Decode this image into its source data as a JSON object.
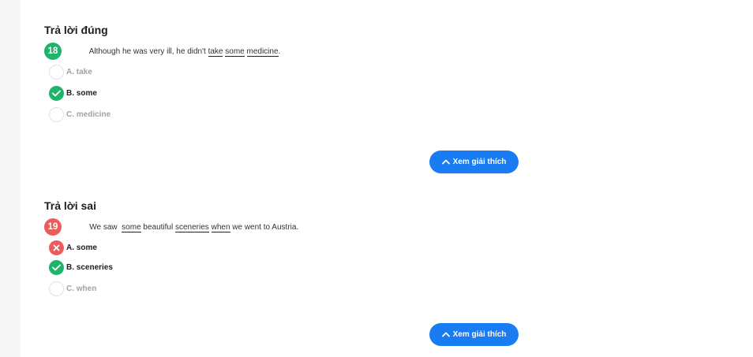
{
  "questions": [
    {
      "status": "Trả lời đúng",
      "number": "18",
      "text_parts": [
        {
          "t": "Although he was very ill, he didn't ",
          "u": false
        },
        {
          "t": "take",
          "u": true
        },
        {
          "t": " ",
          "u": false
        },
        {
          "t": "some",
          "u": true
        },
        {
          "t": " ",
          "u": false
        },
        {
          "t": "medicine",
          "u": true
        },
        {
          "t": ".",
          "u": false
        }
      ],
      "options": [
        {
          "label": "A. take",
          "state": "empty"
        },
        {
          "label": "B. some",
          "state": "correct"
        },
        {
          "label": "C. medicine",
          "state": "empty"
        }
      ],
      "button_label": "Xem giải thích"
    },
    {
      "status": "Trả lời sai",
      "number": "19",
      "text_parts": [
        {
          "t": "We saw  ",
          "u": false
        },
        {
          "t": "some",
          "u": true
        },
        {
          "t": " beautiful ",
          "u": false
        },
        {
          "t": "sceneries",
          "u": true
        },
        {
          "t": " ",
          "u": false
        },
        {
          "t": "when",
          "u": true
        },
        {
          "t": " we went to Austria.",
          "u": false
        }
      ],
      "options": [
        {
          "label": "A. some",
          "state": "wrong"
        },
        {
          "label": "B. sceneries",
          "state": "correct"
        },
        {
          "label": "C. when",
          "state": "empty"
        }
      ],
      "button_label": "Xem giải thích"
    }
  ],
  "colors": {
    "correct": "#1fb36b",
    "wrong": "#ee5b5b",
    "button": "#1a7cf2"
  },
  "icons": {
    "correct": "check-icon",
    "wrong": "close-icon",
    "button": "chevron-up-icon"
  }
}
